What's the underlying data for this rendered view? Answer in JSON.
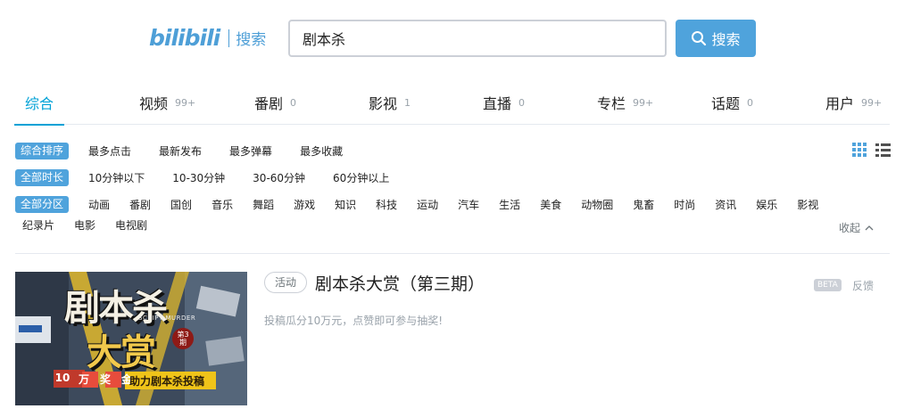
{
  "header": {
    "logo_text": "bilibili",
    "logo_sub": "搜索",
    "search_value": "剧本杀",
    "search_button": "搜索"
  },
  "tabs": [
    {
      "label": "综合",
      "count": ""
    },
    {
      "label": "视频",
      "count": "99+"
    },
    {
      "label": "番剧",
      "count": "0"
    },
    {
      "label": "影视",
      "count": "1"
    },
    {
      "label": "直播",
      "count": "0"
    },
    {
      "label": "专栏",
      "count": "99+"
    },
    {
      "label": "话题",
      "count": "0"
    },
    {
      "label": "用户",
      "count": "99+"
    }
  ],
  "filters": {
    "order": {
      "selected": "综合排序",
      "options": [
        "最多点击",
        "最新发布",
        "最多弹幕",
        "最多收藏"
      ]
    },
    "duration": {
      "selected": "全部时长",
      "options": [
        "10分钟以下",
        "10-30分钟",
        "30-60分钟",
        "60分钟以上"
      ]
    },
    "zone": {
      "selected": "全部分区",
      "options": [
        "动画",
        "番剧",
        "国创",
        "音乐",
        "舞蹈",
        "游戏",
        "知识",
        "科技",
        "运动",
        "汽车",
        "生活",
        "美食",
        "动物圈",
        "鬼畜",
        "时尚",
        "资讯",
        "娱乐",
        "影视"
      ],
      "options_row2": [
        "纪录片",
        "电影",
        "电视剧"
      ]
    },
    "collapse_label": "收起"
  },
  "result": {
    "tag": "活动",
    "title": "剧本杀大赏（第三期）",
    "description": "投稿瓜分10万元，点赞即可参与抽奖!",
    "beta": "BETA",
    "feedback": "反馈",
    "thumb_title_line1": "剧本杀",
    "thumb_title_line2": "大赏",
    "thumb_sub": "SCRIPT MURDER",
    "thumb_issue": "第3期",
    "thumb_prize": [
      "10",
      "万",
      "奖",
      "金"
    ],
    "thumb_cta": "助力剧本杀投稿"
  },
  "colors": {
    "accent": "#00a1d6",
    "button": "#4fa3dc",
    "muted": "#99a2aa"
  }
}
